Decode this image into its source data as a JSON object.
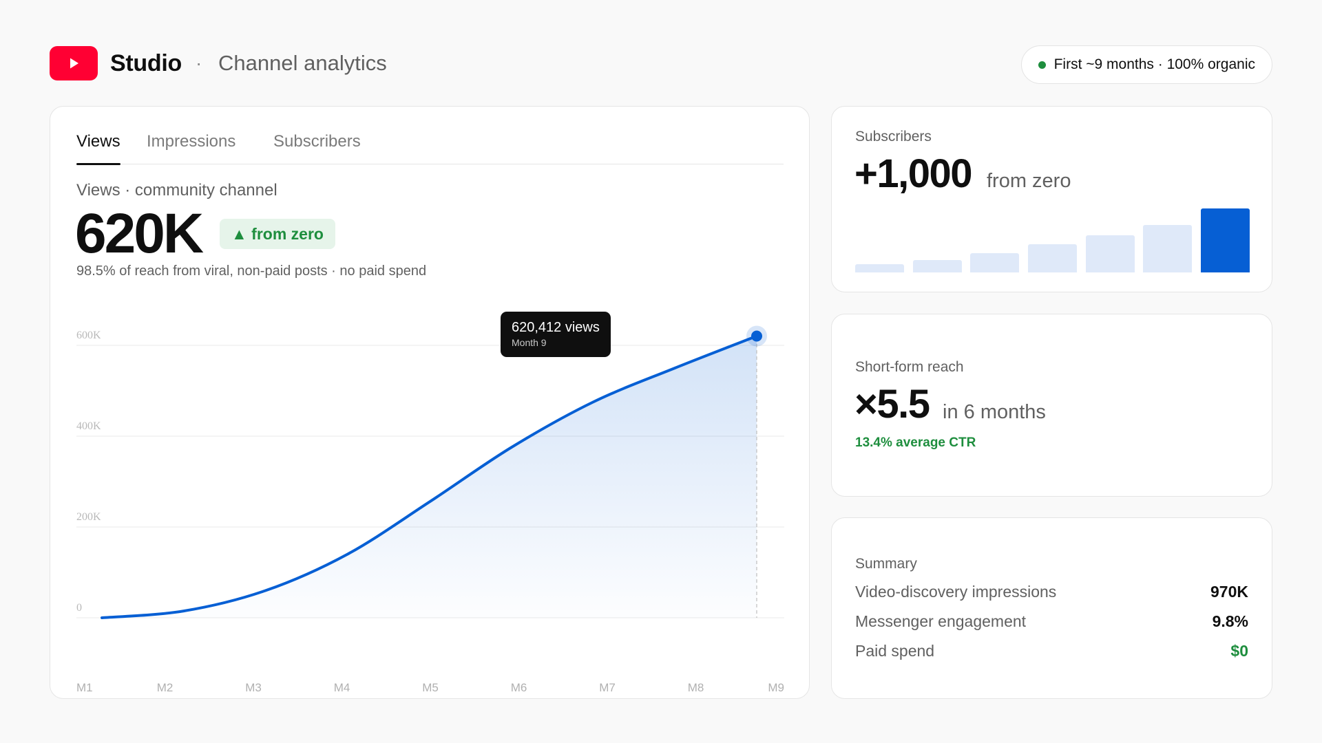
{
  "header": {
    "brand": "Studio",
    "separator": "·",
    "page_title": "Channel analytics",
    "status": "First ~9 months · 100% organic",
    "logo_icon": "play-icon"
  },
  "colors": {
    "brand_red": "#ff0033",
    "accent_blue": "#065fd4",
    "positive_green": "#1e8e3e",
    "bar_light": "#dfe9f9"
  },
  "tabs": [
    {
      "label": "Views",
      "active": true
    },
    {
      "label": "Impressions",
      "active": false
    },
    {
      "label": "Subscribers",
      "active": false
    }
  ],
  "main": {
    "metric_label": "Views · community channel",
    "metric_value": "620K",
    "delta_badge": "▲ from zero",
    "note": "98.5% of reach from viral, non-paid posts · no paid spend"
  },
  "tooltip": {
    "value": "620,412 views",
    "sub": "Month 9"
  },
  "chart_data": {
    "type": "area",
    "title": "",
    "xlabel": "",
    "ylabel": "",
    "categories": [
      "M1",
      "M2",
      "M3",
      "M4",
      "M5",
      "M6",
      "M7",
      "M8",
      "M9"
    ],
    "y_ticks": [
      0,
      200000,
      400000,
      600000
    ],
    "y_tick_labels": [
      "0",
      "200K",
      "400K",
      "600K"
    ],
    "ylim": [
      0,
      600000
    ],
    "grid": true,
    "series": [
      {
        "values": [
          0,
          15000,
          60000,
          140000,
          255000,
          375000,
          475000,
          550000,
          620412
        ],
        "color": "#065fd4"
      }
    ],
    "highlight": {
      "category": "M9",
      "value": 620412
    }
  },
  "subscribers_card": {
    "label": "Subscribers",
    "value": "+1,000",
    "suffix": "from zero",
    "bars": [
      0.13,
      0.19,
      0.3,
      0.44,
      0.58,
      0.74,
      1.0
    ],
    "highlight_last": true
  },
  "reach_card": {
    "label": "Short-form reach",
    "value": "×5.5",
    "suffix": "in 6 months",
    "ctr": "13.4% average CTR"
  },
  "summary_card": {
    "label": "Summary",
    "rows": [
      {
        "key": "Video-discovery impressions",
        "value": "970K",
        "positive": false
      },
      {
        "key": "Messenger engagement",
        "value": "9.8%",
        "positive": false
      },
      {
        "key": "Paid spend",
        "value": "$0",
        "positive": true
      }
    ]
  }
}
